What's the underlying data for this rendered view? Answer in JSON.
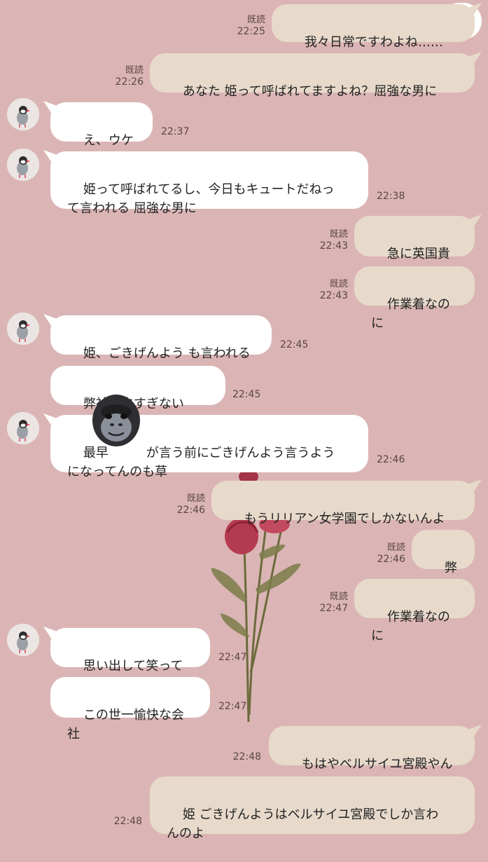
{
  "messages": [
    {
      "side": "out",
      "lines": "我々日常ですわよね……",
      "read": "既読",
      "time": "22:25"
    },
    {
      "side": "out",
      "lines": "あなた 姫って呼ばれてますよね？屈強な男に",
      "read": "既読",
      "time": "22:26"
    },
    {
      "side": "in",
      "lines": "え、ウケる",
      "time": "22:37"
    },
    {
      "side": "in",
      "lines": "姫って呼ばれてるし、今日もキュートだねっ\nて言われる 屈強な男に",
      "time": "22:38"
    },
    {
      "side": "out",
      "lines": "急に英国貴族",
      "read": "既読",
      "time": "22:43"
    },
    {
      "side": "out",
      "lines": "作業着なのに",
      "read": "既読",
      "time": "22:43"
    },
    {
      "side": "in",
      "lines": "姫、ごきげんよう も言われる",
      "time": "22:45"
    },
    {
      "side": "in",
      "lines": "弊社面白すぎないか？",
      "time": "22:45"
    },
    {
      "side": "in",
      "lines": "最早　　　が言う前にごきげんよう言うよう\nになってんのも草",
      "time": "22:46"
    },
    {
      "side": "out",
      "lines": "もうリリアン女学園でしかないんよ",
      "read": "既読",
      "time": "22:46"
    },
    {
      "side": "out",
      "lines": "弊社",
      "read": "既読",
      "time": "22:46"
    },
    {
      "side": "out",
      "lines": "作業着なのに",
      "read": "既読",
      "time": "22:47"
    },
    {
      "side": "in",
      "lines": "思い出して笑ってる",
      "time": "22:47"
    },
    {
      "side": "in",
      "lines": "この世一愉快な会社",
      "time": "22:47"
    },
    {
      "side": "out",
      "lines": "もはやベルサイユ宮殿やん",
      "time": "22:48"
    },
    {
      "side": "out",
      "lines": "姫 ごきげんようはベルサイユ宮殿でしか言わ\nんのよ",
      "time": "22:48"
    }
  ],
  "icons": {
    "announcement": "megaphone-icon",
    "avatar": "bird-avatar-icon",
    "sticker": "gorilla-icon",
    "background": "rose-icon"
  },
  "colors": {
    "background": "#dbb5b5",
    "incoming_bubble": "#ffffff",
    "outgoing_bubble": "#e7dacb"
  }
}
